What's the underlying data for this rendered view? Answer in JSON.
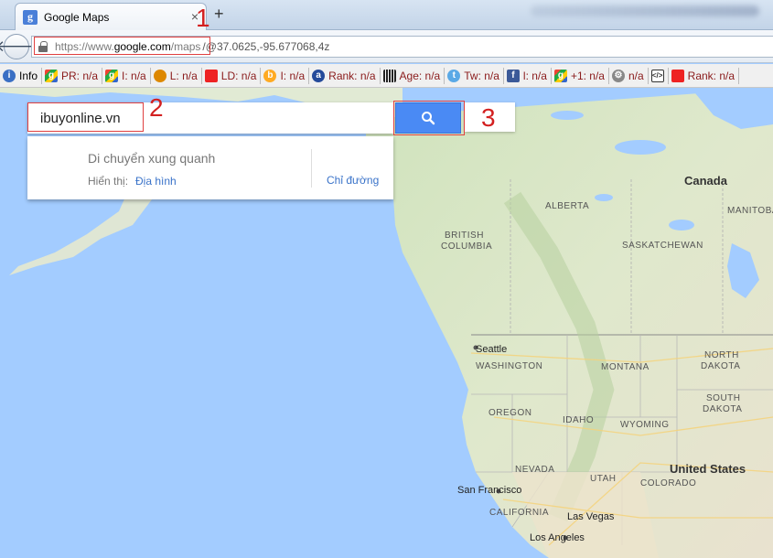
{
  "browser": {
    "tab_title": "Google Maps",
    "tab_close": "×",
    "new_tab": "+",
    "back": "🡐",
    "url_scheme": "https://www.",
    "url_domain": "google.com",
    "url_path": "/maps",
    "url_rest": "/@37.0625,-95.677068,4z"
  },
  "annotations": {
    "one": "1",
    "two": "2",
    "three": "3"
  },
  "seo_toolbar": [
    {
      "icon": "info-icon",
      "glyph": "i",
      "label": "Info",
      "plain": true
    },
    {
      "icon": "google-pr-icon",
      "glyph": "g",
      "label": "PR: n/a"
    },
    {
      "icon": "google-index-icon",
      "glyph": "g",
      "label": "I: n/a"
    },
    {
      "icon": "links-icon",
      "glyph": "",
      "label": "L: n/a"
    },
    {
      "icon": "linkdomain-icon",
      "glyph": "",
      "label": "LD: n/a"
    },
    {
      "icon": "bing-index-icon",
      "glyph": "b",
      "label": "I: n/a"
    },
    {
      "icon": "alexa-rank-icon",
      "glyph": "a",
      "label": "Rank: n/a"
    },
    {
      "icon": "age-icon",
      "glyph": "",
      "label": "Age: n/a"
    },
    {
      "icon": "twitter-icon",
      "glyph": "t",
      "label": "Tw: n/a"
    },
    {
      "icon": "facebook-icon",
      "glyph": "f",
      "label": "l: n/a"
    },
    {
      "icon": "google-plus-icon",
      "glyph": "g",
      "label": "+1: n/a"
    },
    {
      "icon": "gear-icon",
      "glyph": "⚙",
      "label": "n/a"
    },
    {
      "icon": "source-icon",
      "glyph": "</>",
      "label": ""
    },
    {
      "icon": "rank2-icon",
      "glyph": "",
      "label": "Rank: n/a"
    }
  ],
  "search": {
    "value": "ibuyonline.vn",
    "button_icon": "search-icon"
  },
  "dropdown": {
    "title": "Di chuyển xung quanh",
    "show_label": "Hiển thị:",
    "terrain": "Địa hình",
    "directions": "Chỉ đường"
  },
  "map_labels": {
    "canada": "Canada",
    "alberta": "ALBERTA",
    "manitoba": "MANITOBA",
    "british_columbia_1": "BRITISH",
    "british_columbia_2": "COLUMBIA",
    "saskatchewan": "SASKATCHEWAN",
    "seattle": "Seattle",
    "washington": "WASHINGTON",
    "montana": "MONTANA",
    "north_dakota_1": "NORTH",
    "north_dakota_2": "DAKOTA",
    "oregon": "OREGON",
    "idaho": "IDAHO",
    "south_dakota_1": "SOUTH",
    "south_dakota_2": "DAKOTA",
    "wyoming": "WYOMING",
    "united_states": "United States",
    "nevada": "NEVADA",
    "utah": "UTAH",
    "colorado": "COLORADO",
    "san_francisco": "San Francisco",
    "california": "CALIFORNIA",
    "las_vegas": "Las Vegas",
    "los_angeles": "Los Angeles"
  },
  "colors": {
    "ocean": "#a3ccff",
    "land": "#e8e4d8",
    "forest": "#c5dfb0",
    "search_button": "#4a8af4",
    "annotation_red": "#d32020"
  }
}
